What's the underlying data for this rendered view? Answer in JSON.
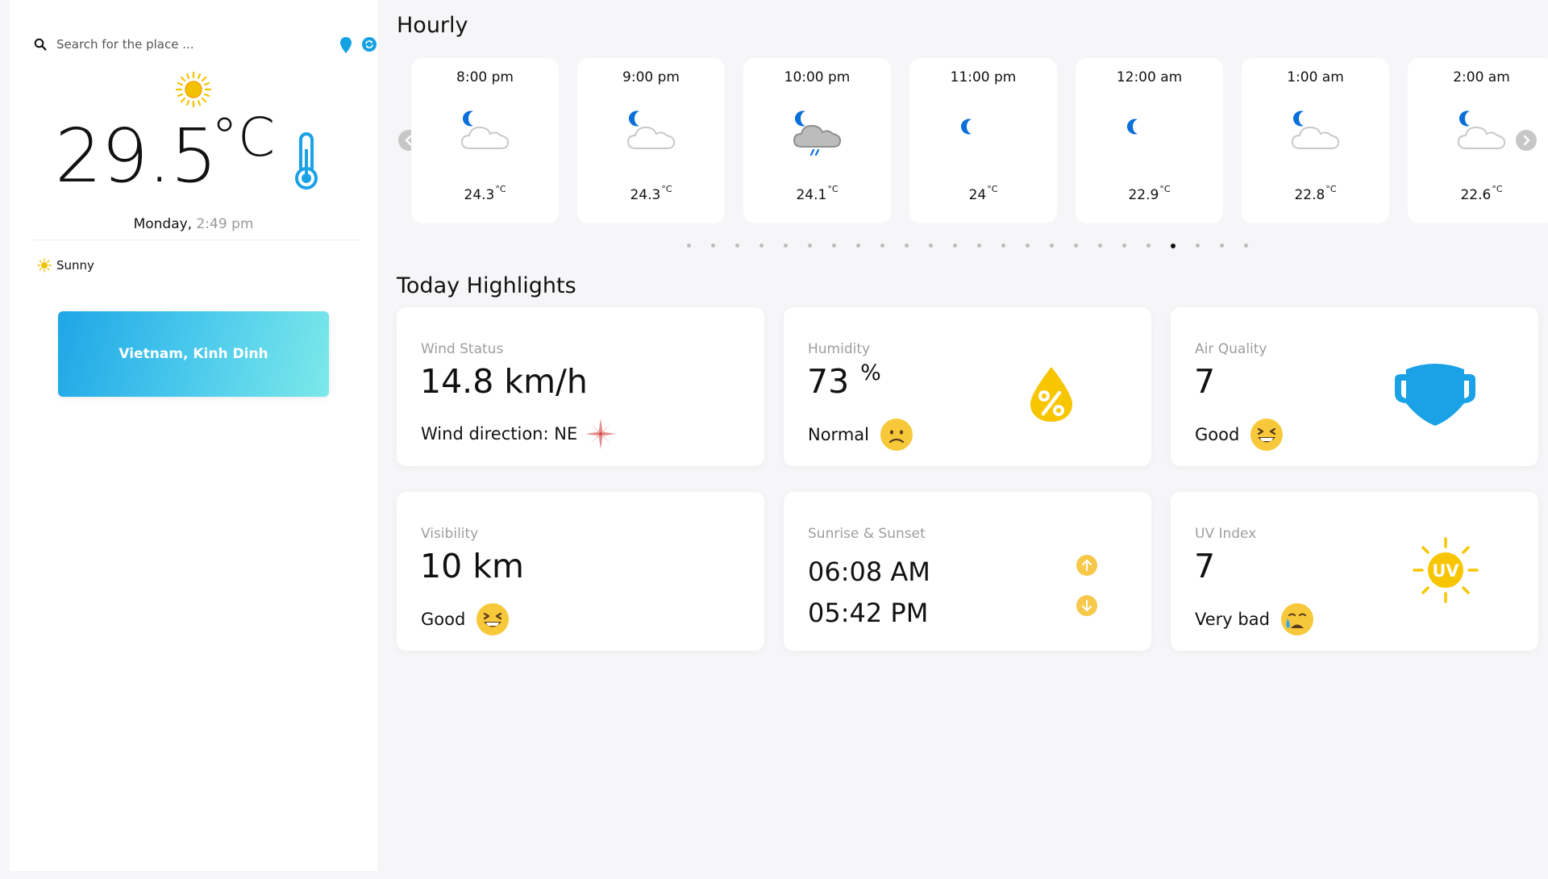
{
  "search": {
    "placeholder": "Search for the place ..."
  },
  "current": {
    "temperature": "29.5",
    "unit": "°C",
    "day": "Monday,",
    "time": "2:49 pm",
    "condition": "Sunny",
    "location": "Vietnam, Kinh Dinh"
  },
  "hourly": {
    "title": "Hourly",
    "items": [
      {
        "time": "8:00 pm",
        "temp": "24.3",
        "unit": "°C",
        "icon": "moon-cloud-icon"
      },
      {
        "time": "9:00 pm",
        "temp": "24.3",
        "unit": "°C",
        "icon": "moon-cloud-icon"
      },
      {
        "time": "10:00 pm",
        "temp": "24.1",
        "unit": "°C",
        "icon": "moon-rain-cloud-icon"
      },
      {
        "time": "11:00 pm",
        "temp": "24",
        "unit": "°C",
        "icon": "moon-icon"
      },
      {
        "time": "12:00 am",
        "temp": "22.9",
        "unit": "°C",
        "icon": "moon-icon"
      },
      {
        "time": "1:00 am",
        "temp": "22.8",
        "unit": "°C",
        "icon": "moon-cloud-icon"
      },
      {
        "time": "2:00 am",
        "temp": "22.6",
        "unit": "°C",
        "icon": "moon-cloud-icon"
      }
    ],
    "pager": {
      "total": 24,
      "active": 21
    }
  },
  "highlights": {
    "title": "Today Highlights",
    "wind": {
      "label": "Wind Status",
      "value": "14.8 km/h",
      "direction": "Wind direction: NE"
    },
    "humidity": {
      "label": "Humidity",
      "value": "73",
      "unit": "%",
      "status": "Normal"
    },
    "air": {
      "label": "Air Quality",
      "value": "7",
      "status": "Good"
    },
    "visibility": {
      "label": "Visibility",
      "value": "10 km",
      "status": "Good"
    },
    "sun": {
      "label": "Sunrise & Sunset",
      "sunrise": "06:08 AM",
      "sunset": "05:42 PM"
    },
    "uv": {
      "label": "UV Index",
      "value": "7",
      "status": "Very bad",
      "badge": "UV"
    }
  },
  "colors": {
    "accent_blue": "#1ea6e6",
    "moon_blue": "#0a6fd8",
    "sun_yellow": "#f2c200",
    "mask_blue": "#1aa1e6"
  }
}
